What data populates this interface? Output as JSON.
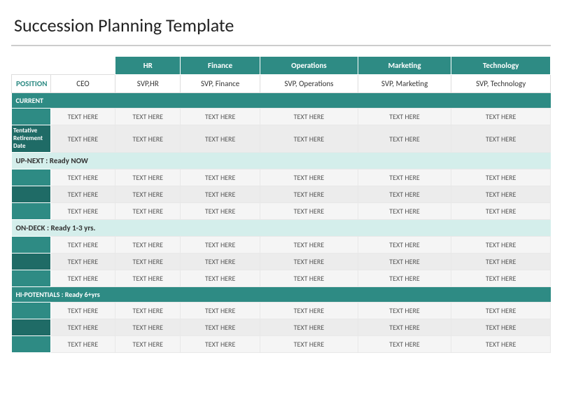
{
  "title": "Succession Planning Template",
  "columns": {
    "col1_empty": "",
    "col2_ceo": "CEO",
    "col3_hr": "HR",
    "col4_finance": "Finance",
    "col5_operations": "Operations",
    "col6_marketing": "Marketing",
    "col7_technology": "Technology"
  },
  "positions": {
    "label": "POSITION",
    "ceo": "CEO",
    "hr": "SVP,HR",
    "finance": "SVP, Finance",
    "operations": "SVP, Operations",
    "marketing": "SVP, Marketing",
    "technology": "SVP, Technology"
  },
  "sections": {
    "current_label": "CURRENT",
    "tentative_label": "Tentative Retirement Date",
    "upnext_label": "UP-NEXT : Ready NOW",
    "ondeck_label": "ON-DECK : Ready 1-3 yrs.",
    "hipotentials_label": "HI-POTENTIALS : Ready 6+yrs"
  },
  "placeholder": "TEXT HERE"
}
